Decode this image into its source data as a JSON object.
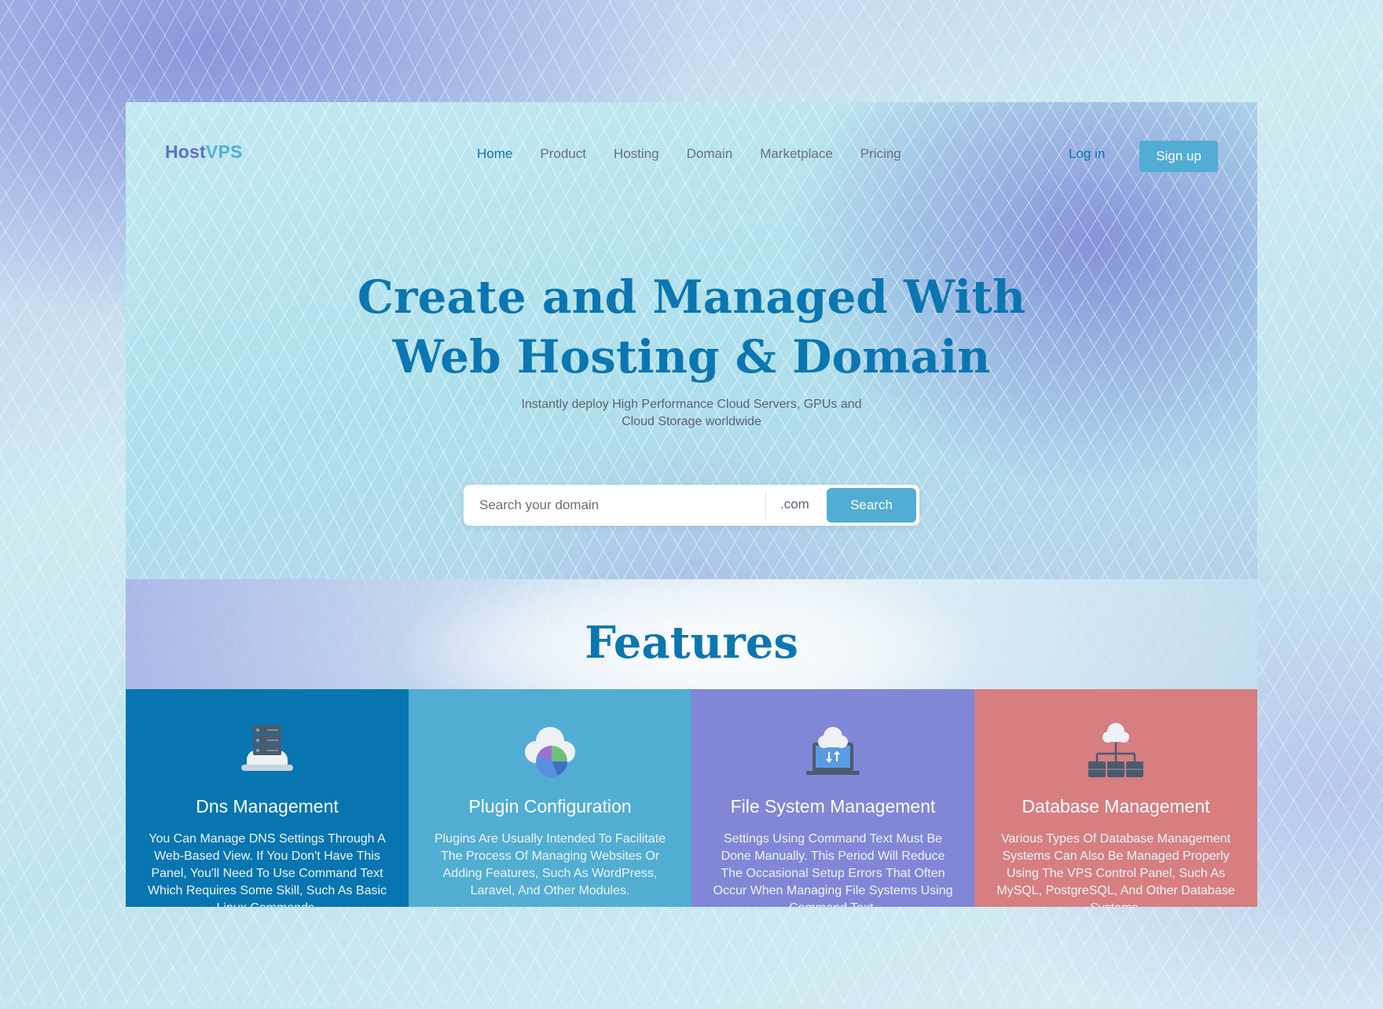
{
  "brand": {
    "part1": "Host",
    "part2": "VPS"
  },
  "nav": {
    "items": [
      {
        "label": "Home",
        "active": true
      },
      {
        "label": "Product",
        "active": false
      },
      {
        "label": "Hosting",
        "active": false
      },
      {
        "label": "Domain",
        "active": false
      },
      {
        "label": "Marketplace",
        "active": false
      },
      {
        "label": "Pricing",
        "active": false
      }
    ],
    "login_label": "Log in",
    "signup_label": "Sign up"
  },
  "hero": {
    "title_line1": "Create and Managed With",
    "title_line2": "Web Hosting & Domain",
    "subtitle_line1": "Instantly deploy High Performance Cloud Servers, GPUs and",
    "subtitle_line2": "Cloud Storage worldwide"
  },
  "search": {
    "placeholder": "Search your domain",
    "value": "",
    "tld": ".com",
    "button_label": "Search"
  },
  "features": {
    "title": "Features",
    "cards": [
      {
        "title": "Dns Management",
        "description": "You Can Manage DNS Settings Through A Web-Based View. If You Don't Have This Panel, You'll Need To Use Command Text Which Requires Some Skill, Such As Basic Linux Commands.",
        "color": "#0775b0",
        "icon": "server-cloud-icon"
      },
      {
        "title": "Plugin Configuration",
        "description": "Plugins Are Usually Intended To Facilitate The Process Of Managing Websites Or Adding Features, Such As WordPress, Laravel, And Other Modules.",
        "color": "#52add2",
        "icon": "cloud-chart-icon"
      },
      {
        "title": "File System Management",
        "description": "Settings Using Command Text Must Be Done Manually. This Period Will Reduce The Occasional Setup Errors That Often Occur When Managing File Systems Using Command Text.",
        "color": "#8186d7",
        "icon": "cloud-laptop-icon"
      },
      {
        "title": "Database Management",
        "description": "Various Types Of Database Management Systems Can Also Be Managed Properly Using The VPS Control Panel, Such As MySQL, PostgreSQL, And Other Database Systems.",
        "color": "#d67e80",
        "icon": "cloud-network-icon"
      }
    ]
  }
}
